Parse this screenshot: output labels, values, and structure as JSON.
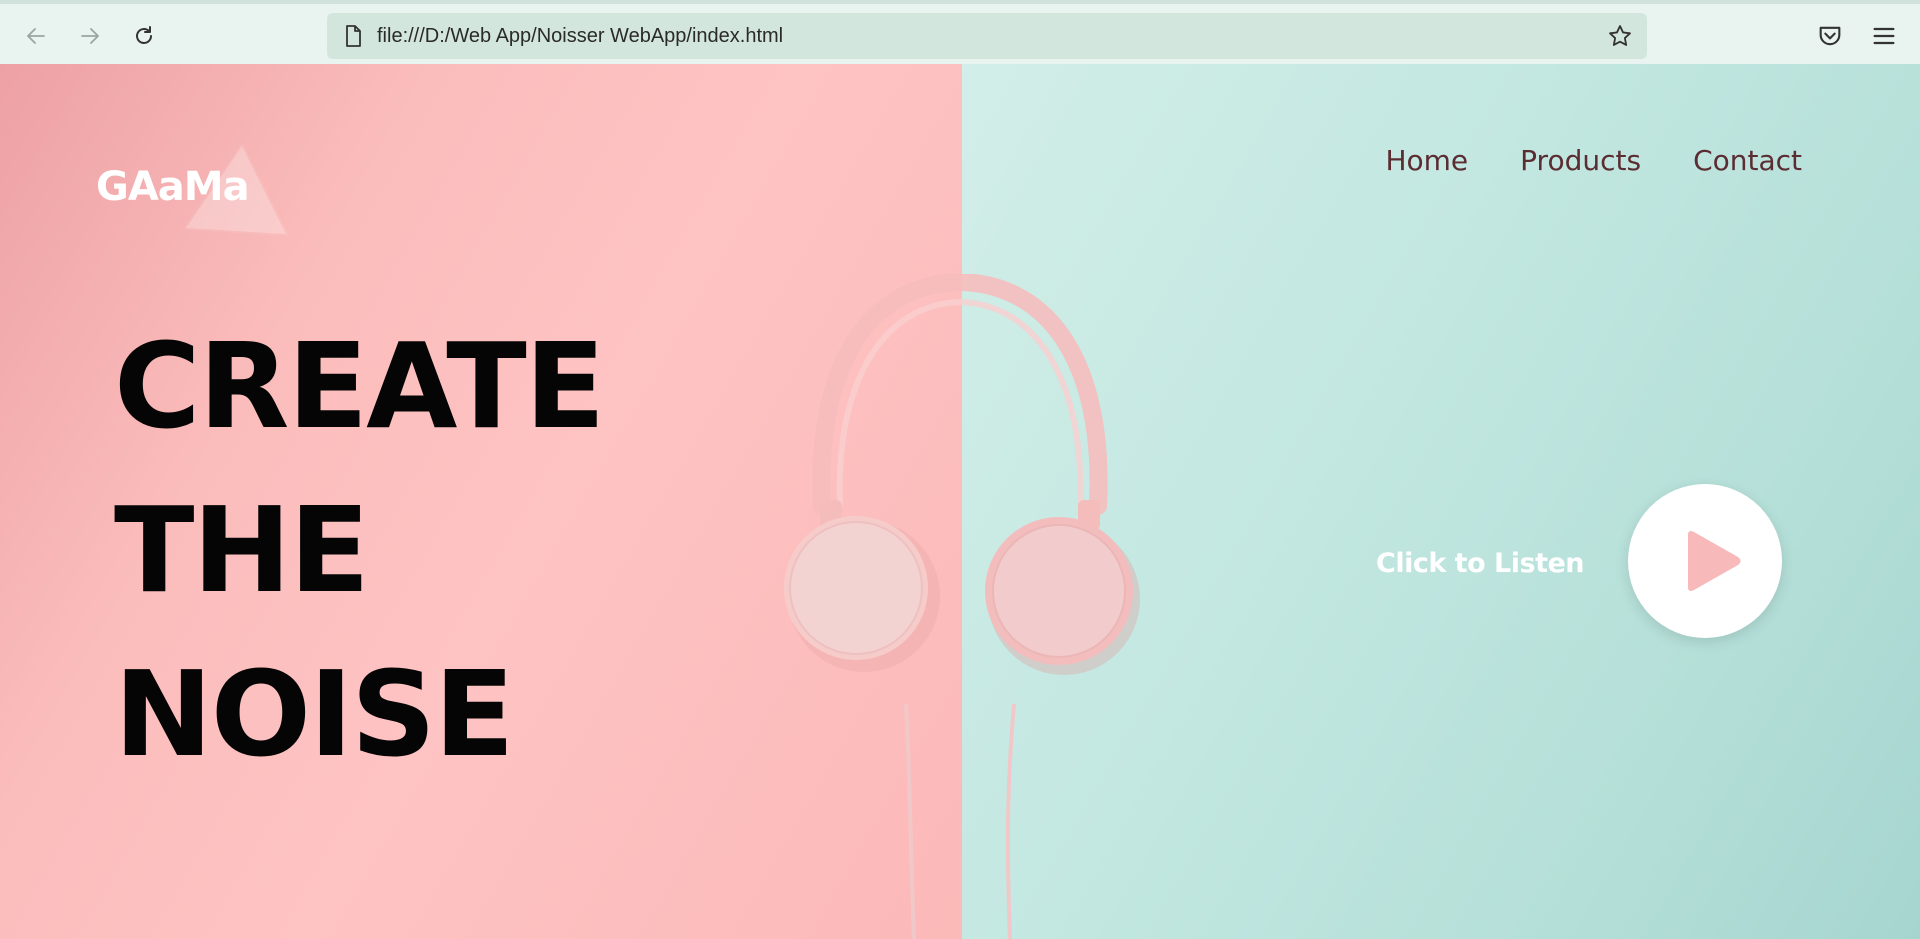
{
  "browser": {
    "url": "file:///D:/Web App/Noisser WebApp/index.html",
    "icons": {
      "back": "arrow-left-icon",
      "forward": "arrow-right-icon",
      "reload": "reload-icon",
      "page": "file-icon",
      "bookmark": "star-icon",
      "pocket": "pocket-icon",
      "menu": "hamburger-menu-icon"
    }
  },
  "site": {
    "logo": "GAaMa",
    "nav": [
      "Home",
      "Products",
      "Contact"
    ],
    "headline": [
      "CREATE",
      "THE",
      "NOISE"
    ],
    "cta_label": "Click to Listen",
    "cta_icon": "play-icon"
  },
  "colors": {
    "left_bg": "#fec3c3",
    "right_bg": "#c3e7e1",
    "nav_text": "#5b2d33",
    "headline_text": "#050505",
    "play_icon": "#f7b9b9"
  }
}
